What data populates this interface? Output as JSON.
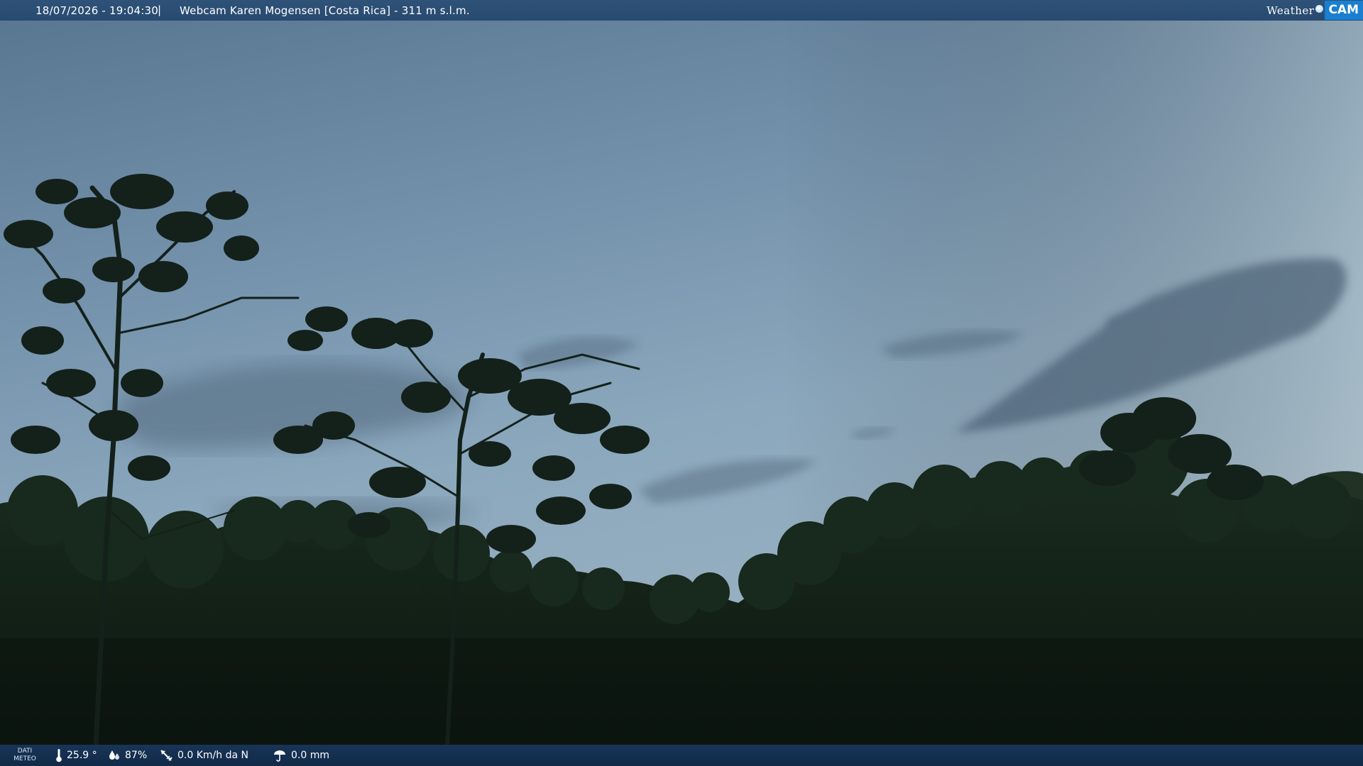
{
  "header": {
    "timestamp": "18/07/2026 - 19:04:30",
    "separator": "|",
    "title": "Webcam Karen Mogensen [Costa Rica] - 311 m s.l.m."
  },
  "logo": {
    "word": "Weather",
    "cam": "CAM"
  },
  "weather": {
    "label_line1": "DATI",
    "label_line2": "METEO",
    "temperature": "25.9 °",
    "humidity": "87%",
    "wind": "0.0 Km/h da N",
    "rain": "0.0 mm",
    "icons": {
      "temperature": "thermometer-icon",
      "humidity": "humidity-drops-icon",
      "wind": "wind-vane-icon",
      "rain": "rain-gauge-icon"
    }
  },
  "colors": {
    "sky_top": "#5c7a96",
    "sky_mid": "#8aa6bd",
    "cloud": "#4f6579",
    "foliage": "#14241a",
    "bar_top": "#2f5278",
    "bar_bottom": "#183457",
    "logo_accent": "#1a7fd0"
  }
}
